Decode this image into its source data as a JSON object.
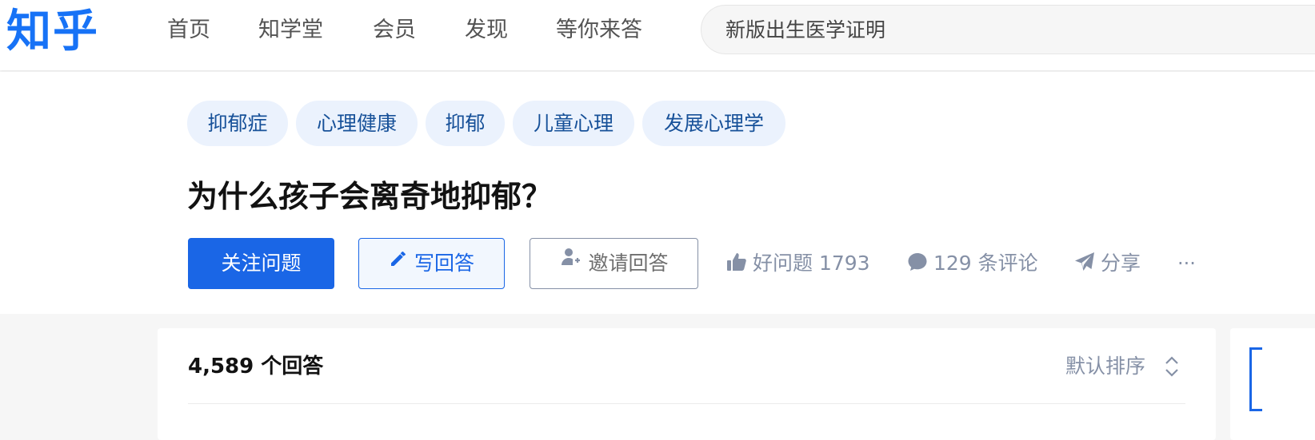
{
  "header": {
    "logo": "知乎",
    "nav": [
      "首页",
      "知学堂",
      "会员",
      "发现",
      "等你来答"
    ],
    "search_placeholder": "新版出生医学证明"
  },
  "question": {
    "tags": [
      "抑郁症",
      "心理健康",
      "抑郁",
      "儿童心理",
      "发展心理学"
    ],
    "title": "为什么孩子会离奇地抑郁？",
    "buttons": {
      "follow": "关注问题",
      "write": "写回答",
      "invite": "邀请回答"
    },
    "actions": {
      "good_question": "好问题 1793",
      "comments": "129 条评论",
      "share": "分享",
      "more": "···"
    }
  },
  "answers": {
    "count": "4,589 个回答",
    "sort_label": "默认排序"
  },
  "colors": {
    "brand": "#1772f6",
    "primary_button": "#1a66e6",
    "tag_bg": "#ebf2fd",
    "tag_text": "#175199",
    "muted": "#8590a6"
  }
}
